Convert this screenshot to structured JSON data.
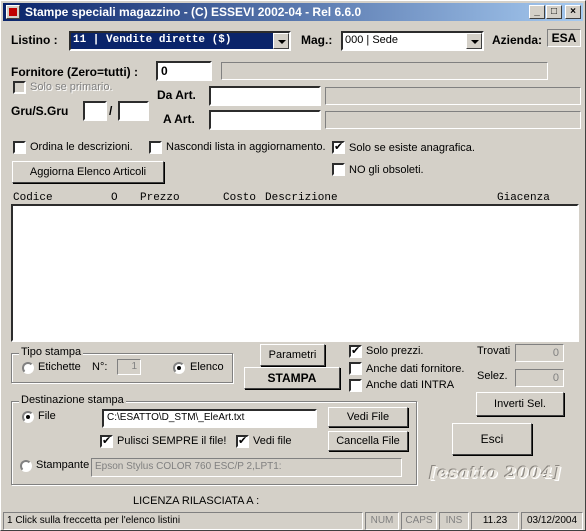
{
  "window": {
    "title": "Stampe speciali magazzino - (C) ESSEVI 2002-04 - Rel 6.6.0",
    "controls": {
      "minimize": "_",
      "maximize": "□",
      "close": "×"
    }
  },
  "listino": {
    "label": "Listino :",
    "value": "11 | Vendite dirette      ($)"
  },
  "mag": {
    "label": "Mag.:",
    "value": "000 | Sede"
  },
  "azienda": {
    "label": "Azienda:",
    "value": "ESA"
  },
  "fornitore": {
    "label": "Fornitore (Zero=tutti) :",
    "value": "0",
    "desc": ""
  },
  "solo_primario": {
    "label": "Solo se primario.",
    "checked": false
  },
  "da_art": {
    "label": "Da Art.",
    "value": "",
    "desc": ""
  },
  "a_art": {
    "label": "A Art.",
    "value": "",
    "desc": ""
  },
  "gru": {
    "label": "Gru/S.Gru",
    "sep": "/",
    "gru_value": "",
    "sgru_value": ""
  },
  "options": {
    "ordina": {
      "label": "Ordina le descrizioni.",
      "checked": false
    },
    "nascondi": {
      "label": "Nascondi lista in aggiornamento.",
      "checked": false
    },
    "solo_anagrafica": {
      "label": "Solo se esiste anagrafica.",
      "checked": true
    },
    "no_obsoleti": {
      "label": "NO gli obsoleti.",
      "checked": false
    }
  },
  "aggiorna_button": "Aggiorna Elenco Articoli",
  "list": {
    "columns": [
      "Codice",
      "O",
      "Prezzo",
      "Costo",
      "Descrizione",
      "Giacenza"
    ],
    "rows": []
  },
  "tipo_stampa": {
    "title": "Tipo stampa",
    "etichette": "Etichette",
    "n_label": "N°:",
    "n_value": "1",
    "elenco": "Elenco",
    "selected": "elenco"
  },
  "parametri_button": "Parametri",
  "stampa_button": "STAMPA",
  "print_options": {
    "solo_prezzi": {
      "label": "Solo prezzi.",
      "checked": true
    },
    "dati_fornitore": {
      "label": "Anche dati fornitore.",
      "checked": false
    },
    "dati_intra": {
      "label": "Anche dati INTRA",
      "checked": false
    }
  },
  "counters": {
    "trovati_label": "Trovati",
    "trovati_value": "0",
    "selez_label": "Selez.",
    "selez_value": "0"
  },
  "inverti_button": "Inverti Sel.",
  "esci_button": "Esci",
  "destinazione": {
    "title": "Destinazione stampa",
    "file_label": "File",
    "file_path": "C:\\ESATTO\\D_STM\\_EleArt.txt",
    "vedi_file_button": "Vedi File",
    "cancella_file_button": "Cancella File",
    "pulisci": {
      "label": "Pulisci SEMPRE il file!",
      "checked": true
    },
    "vedi": {
      "label": "Vedi file",
      "checked": true
    },
    "stampante_label": "Stampante",
    "stampante_value": "Epson Stylus COLOR 760 ESC/P 2,LPT1:",
    "selected": "file"
  },
  "brand": "[esatto 2004]",
  "licenza": "LICENZA RILASCIATA A :",
  "statusbar": {
    "message": "1 Click sulla freccetta per l'elenco listini",
    "num": "NUM",
    "caps": "CAPS",
    "ins": "INS",
    "time": "11.23",
    "date": "03/12/2004"
  },
  "colors": {
    "title_start": "#0a246a",
    "title_end": "#a6caf0",
    "face": "#d4d0c8",
    "listino_bg": "#0a246a"
  }
}
